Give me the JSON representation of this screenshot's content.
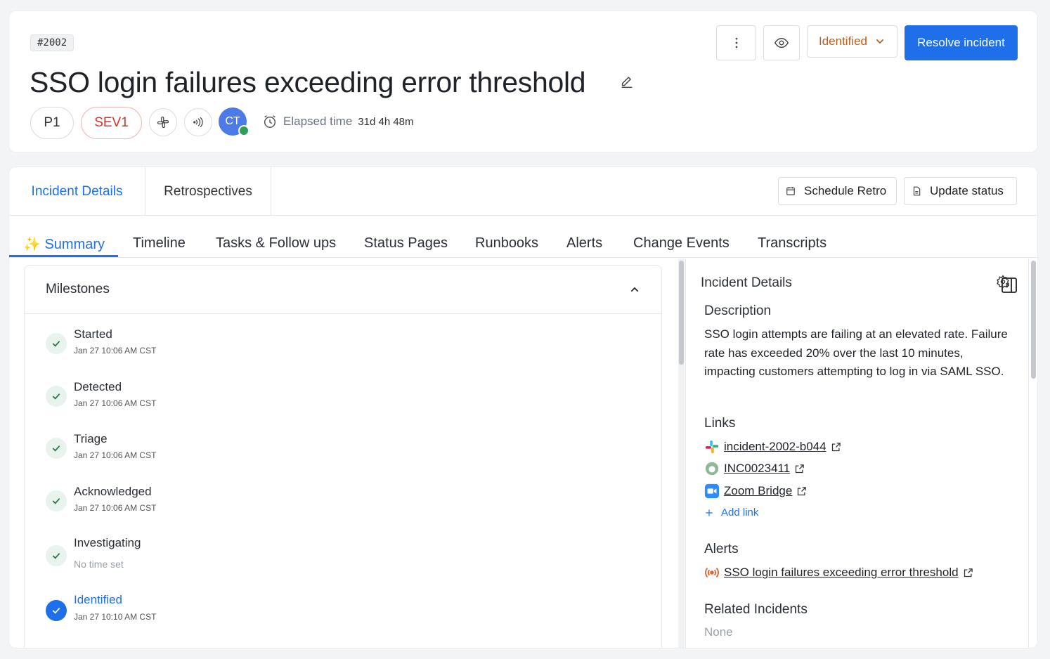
{
  "header": {
    "incident_id": "#2002",
    "title": "SSO login failures exceeding error threshold",
    "priority": "P1",
    "severity": "SEV1",
    "avatar_initials": "CT",
    "elapsed_label": "Elapsed time",
    "elapsed_value": "31d 4h 48m",
    "status": "Identified",
    "resolve_label": "Resolve incident"
  },
  "tabs": {
    "top": [
      "Incident Details",
      "Retrospectives"
    ],
    "actions": [
      "Schedule Retro",
      "Update status"
    ],
    "sub": [
      {
        "icon": "✨",
        "label": "Summary"
      },
      {
        "label": "Timeline"
      },
      {
        "label": "Tasks & Follow ups"
      },
      {
        "label": "Status Pages"
      },
      {
        "label": "Runbooks"
      },
      {
        "label": "Alerts"
      },
      {
        "label": "Change Events"
      },
      {
        "label": "Transcripts"
      }
    ]
  },
  "milestones": {
    "title": "Milestones",
    "items": [
      {
        "label": "Started",
        "time": "Jan 27 10:06 AM CST"
      },
      {
        "label": "Detected",
        "time": "Jan 27 10:06 AM CST"
      },
      {
        "label": "Triage",
        "time": "Jan 27 10:06 AM CST"
      },
      {
        "label": "Acknowledged",
        "time": "Jan 27 10:06 AM CST"
      },
      {
        "label": "Investigating",
        "time": "No time set"
      },
      {
        "label": "Identified",
        "time": "Jan 27 10:10 AM CST"
      }
    ]
  },
  "details": {
    "title": "Incident Details",
    "description_heading": "Description",
    "description": "SSO login attempts are failing at an elevated rate. Failure rate has exceeded 20% over the last 10 minutes, impacting customers attempting to log in via SAML SSO.",
    "links_heading": "Links",
    "links": [
      "incident-2002-b044",
      "INC0023411",
      "Zoom Bridge"
    ],
    "add_link": "Add link",
    "alerts_heading": "Alerts",
    "alert": "SSO login failures exceeding error threshold",
    "related_heading": "Related Incidents",
    "related_value": "None"
  },
  "colors": {
    "accent": "#1f6feb",
    "severity": "#d6312f",
    "status": "#c05c17",
    "online": "#2f9e5c"
  }
}
